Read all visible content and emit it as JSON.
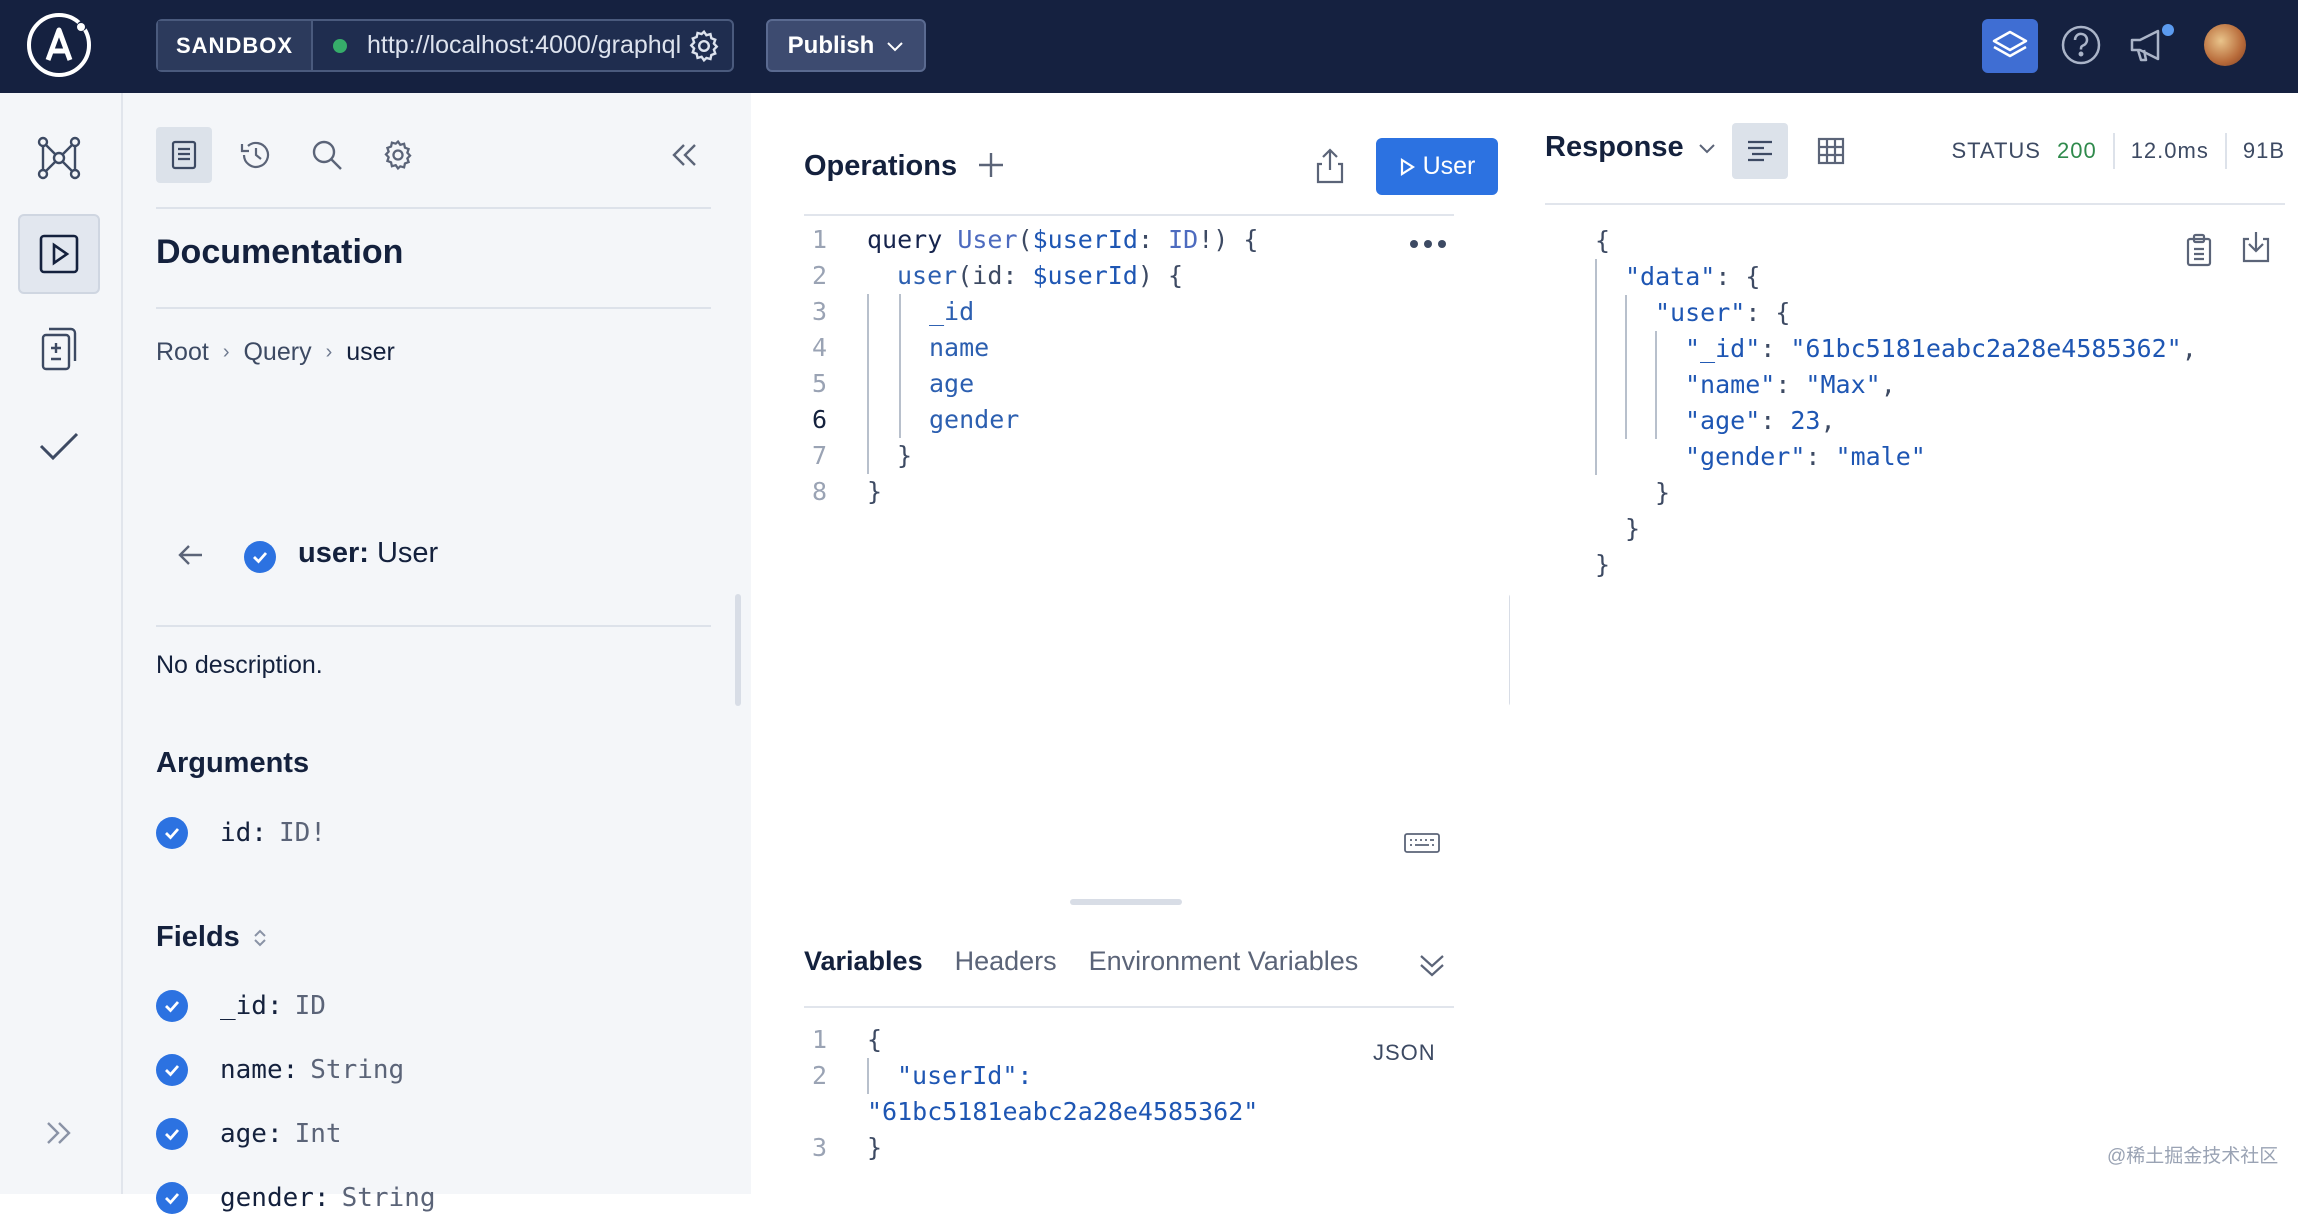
{
  "topbar": {
    "sandbox_label": "SANDBOX",
    "url": "http://localhost:4000/graphql",
    "publish_label": "Publish",
    "status_color": "#36ad6a"
  },
  "rail": {
    "items": [
      {
        "icon": "schema-graph-icon"
      },
      {
        "icon": "explorer-play-icon",
        "active": true
      },
      {
        "icon": "diff-icon"
      },
      {
        "icon": "checks-icon"
      }
    ],
    "expand_icon": "double-chevron-right-icon"
  },
  "docs": {
    "title": "Documentation",
    "breadcrumb": [
      "Root",
      "Query",
      "user"
    ],
    "field_name": "user:",
    "field_type": "User",
    "description": "No description.",
    "arguments_title": "Arguments",
    "arguments": [
      {
        "name": "id:",
        "type": "ID!"
      }
    ],
    "fields_title": "Fields",
    "fields": [
      {
        "name": "_id:",
        "type": "ID"
      },
      {
        "name": "name:",
        "type": "String"
      },
      {
        "name": "age:",
        "type": "Int"
      },
      {
        "name": "gender:",
        "type": "String"
      }
    ]
  },
  "operations": {
    "title": "Operations",
    "run_label": "User",
    "line_numbers": [
      "1",
      "2",
      "3",
      "4",
      "5",
      "6",
      "7",
      "8"
    ],
    "code": {
      "l1_kw": "query",
      "l1_name": "User",
      "l1_var": "$userId",
      "l1_colon": ":",
      "l1_type": "ID",
      "l1_tail": "!) {",
      "l2_field": "user",
      "l2_arg": "(id: ",
      "l2_var": "$userId",
      "l2_tail": ") {",
      "fields": [
        "_id",
        "name",
        "age",
        "gender"
      ],
      "close_inner": "}",
      "close_outer": "}"
    }
  },
  "variables": {
    "tabs": [
      "Variables",
      "Headers",
      "Environment Variables"
    ],
    "format_label": "JSON",
    "line_numbers": [
      "1",
      "2",
      "3"
    ],
    "open": "{",
    "key": "\"userId\":",
    "value": "\"61bc5181eabc2a28e4585362\"",
    "close": "}"
  },
  "response": {
    "title": "Response",
    "status_label": "STATUS",
    "status_code": "200",
    "time": "12.0ms",
    "size": "91B",
    "json": {
      "open": "{",
      "data_key": "\"data\"",
      "user_key": "\"user\"",
      "rows": [
        {
          "key": "\"_id\"",
          "value": "\"61bc5181eabc2a28e4585362\""
        },
        {
          "key": "\"name\"",
          "value": "\"Max\""
        },
        {
          "key": "\"age\"",
          "value": "23"
        },
        {
          "key": "\"gender\"",
          "value": "\"male\""
        }
      ],
      "close": "}"
    }
  },
  "watermark": "@稀土掘金技术社区"
}
